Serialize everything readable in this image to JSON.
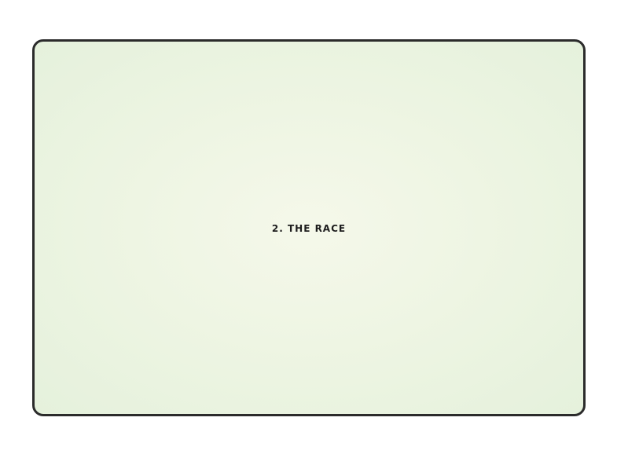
{
  "slide": {
    "title": "2. THE RACE"
  },
  "colors": {
    "background": "#ffffff",
    "slide_fill": "#eef5e3",
    "border": "#2b2b2b",
    "text": "#1d1d1d"
  }
}
